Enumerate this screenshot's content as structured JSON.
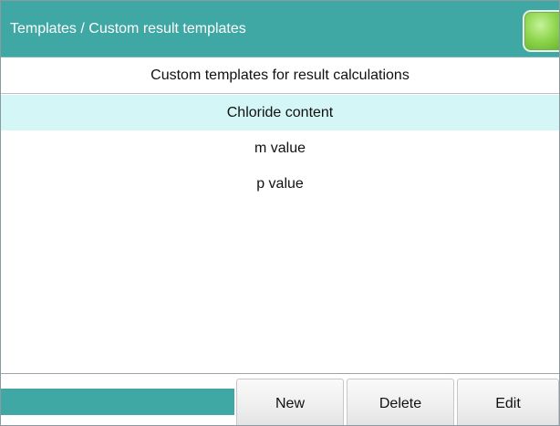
{
  "window": {
    "title": "Templates / Custom result templates"
  },
  "list": {
    "header": "Custom templates for result calculations",
    "items": [
      {
        "label": "Chloride content",
        "selected": true
      },
      {
        "label": "m value",
        "selected": false
      },
      {
        "label": "p value",
        "selected": false
      }
    ]
  },
  "toolbar": {
    "new_label": "New",
    "delete_label": "Delete",
    "edit_label": "Edit"
  },
  "colors": {
    "accent": "#3fa8a4",
    "selection": "#d4f6f6",
    "status_light": "#8fd64e"
  },
  "icons": {
    "status": "status-light-icon"
  }
}
